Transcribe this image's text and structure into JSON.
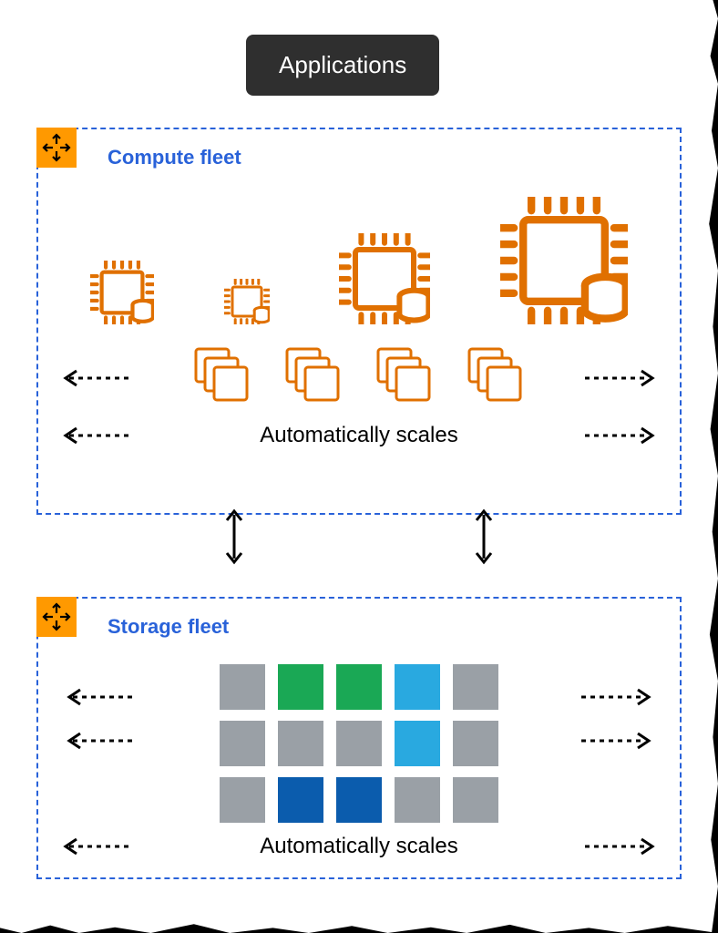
{
  "header": {
    "title": "Applications"
  },
  "compute": {
    "title": "Compute fleet",
    "scale_label": "Automatically scales",
    "icon": "scale-icon",
    "chips": [
      {
        "size": 70
      },
      {
        "size": 50
      },
      {
        "size": 100
      },
      {
        "size": 140
      }
    ],
    "stacks": 4
  },
  "storage": {
    "title": "Storage fleet",
    "scale_label": "Automatically scales",
    "icon": "scale-icon",
    "grid": [
      [
        "gray",
        "green",
        "green",
        "lblue",
        "gray"
      ],
      [
        "gray",
        "gray",
        "gray",
        "lblue",
        "gray"
      ],
      [
        "gray",
        "dblue",
        "dblue",
        "gray",
        "gray"
      ]
    ]
  },
  "colors": {
    "accent": "#ff9900",
    "panel_border": "#2962d9",
    "chip_stroke": "#e07000"
  }
}
